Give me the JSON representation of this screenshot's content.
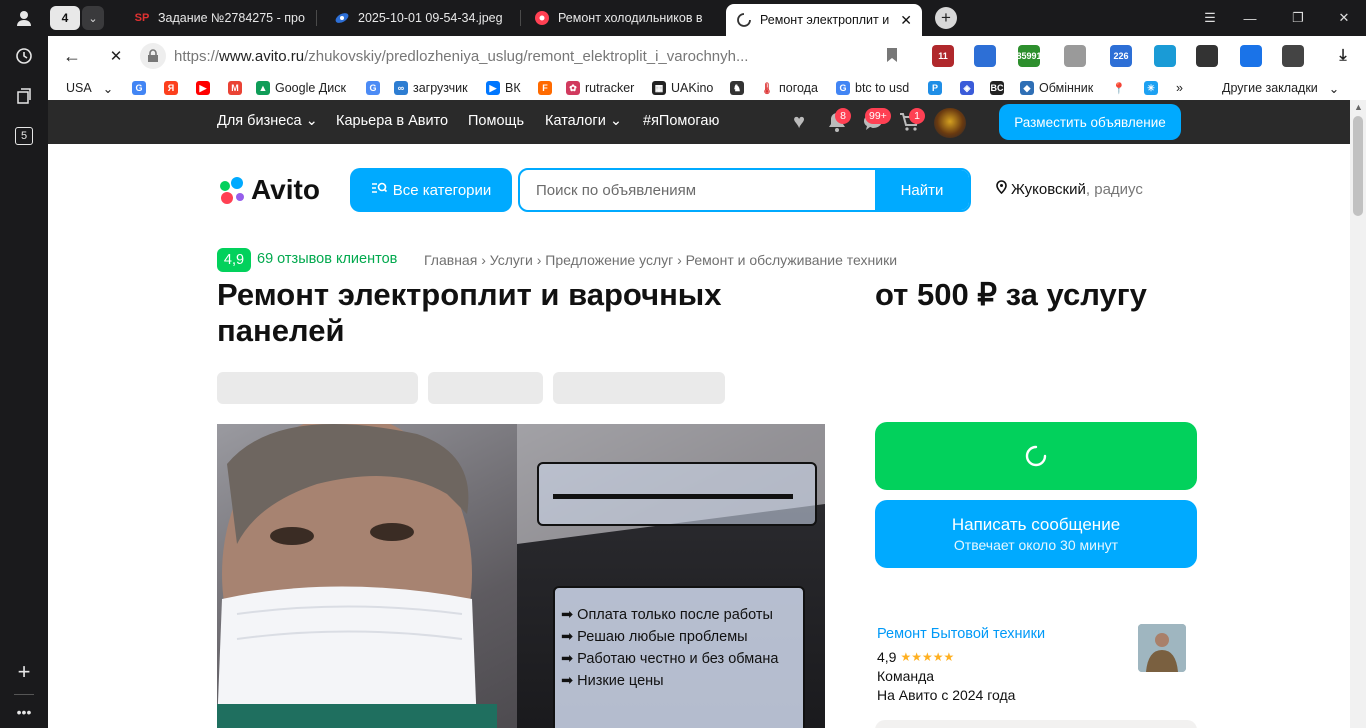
{
  "browser": {
    "tab_count": "4",
    "sidebar_count": "5",
    "tabs": [
      {
        "label": "Задание №2784275 - про",
        "icon": "SP"
      },
      {
        "label": "2025-10-01 09-54-34.jpeg"
      },
      {
        "label": "Ремонт холодильников в"
      },
      {
        "label": "Ремонт электроплит и в"
      }
    ],
    "url_scheme": "https://",
    "url_host": "www.avito.ru",
    "url_path": "/zhukovskiy/predlozheniya_uslug/remont_elektroplit_i_varochnyh...",
    "extensions": [
      {
        "name": "ext-11",
        "label": "11",
        "color": "#b0282c"
      },
      {
        "name": "ext-globe",
        "label": "",
        "color": "#2d6fd6"
      },
      {
        "name": "ext-85991",
        "label": "85991",
        "color": "#2d8f2d"
      },
      {
        "name": "ext-suitcase",
        "label": "",
        "color": "#9a9a9a"
      },
      {
        "name": "ext-226",
        "label": "226",
        "color": "#2d6fd6"
      },
      {
        "name": "ext-diamond",
        "label": "",
        "color": "#1a9bd6"
      },
      {
        "name": "ext-arrow",
        "label": "",
        "color": "#333"
      },
      {
        "name": "ext-download",
        "label": "",
        "color": "#1a73e8"
      },
      {
        "name": "ext-puzzle",
        "label": "",
        "color": "#444"
      }
    ],
    "bookmarks": [
      {
        "label": "USA",
        "icon": "",
        "color": "#fff"
      },
      {
        "label": "",
        "icon": "G",
        "color": "#4285f4"
      },
      {
        "label": "",
        "icon": "Я",
        "color": "#fc3f1d"
      },
      {
        "label": "",
        "icon": "▶",
        "color": "#ff0000"
      },
      {
        "label": "",
        "icon": "M",
        "color": "#ea4335"
      },
      {
        "label": "Google Диск",
        "icon": "▲",
        "color": "#0f9d58"
      },
      {
        "label": "",
        "icon": "G",
        "color": "#4c8bf5"
      },
      {
        "label": "загрузчик",
        "icon": "∞",
        "color": "#2d7dd2"
      },
      {
        "label": "ВК",
        "icon": "▶",
        "color": "#0077ff"
      },
      {
        "label": "",
        "icon": "F",
        "color": "#ff6a00"
      },
      {
        "label": "rutracker",
        "icon": "✿",
        "color": "#d13a5e"
      },
      {
        "label": "UAKino",
        "icon": "▦",
        "color": "#222"
      },
      {
        "label": "",
        "icon": "♞",
        "color": "#333"
      },
      {
        "label": "погода",
        "icon": "🌡",
        "color": "#fff"
      },
      {
        "label": "btc to usd",
        "icon": "G",
        "color": "#4285f4"
      },
      {
        "label": "",
        "icon": "P",
        "color": "#1f8ee6"
      },
      {
        "label": "",
        "icon": "◈",
        "color": "#3a5bd9"
      },
      {
        "label": "",
        "icon": "BC",
        "color": "#222"
      },
      {
        "label": "Обмінник",
        "icon": "◆",
        "color": "#2f6fb5"
      },
      {
        "label": "",
        "icon": "📍",
        "color": "#fff"
      },
      {
        "label": "",
        "icon": "✳",
        "color": "#1da1f2"
      }
    ],
    "more_bookmarks": "»",
    "other_bookmarks": "Другие закладки"
  },
  "avito": {
    "nav": {
      "business": "Для бизнеса",
      "career": "Карьера в Авито",
      "help": "Помощь",
      "catalogs": "Каталоги",
      "help_tag": "#яПомогаю",
      "notif_badge": "8",
      "messages_badge": "99+",
      "cart_badge": "1",
      "post_button": "Разместить объявление"
    },
    "logo_text": "Avito",
    "all_categories": "Все категории",
    "search_placeholder": "Поиск по объявлениям",
    "search_button": "Найти",
    "location": "Жуковский",
    "location_suffix": ", радиус",
    "rating": "4,9",
    "reviews": "69 отзывов клиентов",
    "breadcrumbs": [
      "Главная",
      "Услуги",
      "Предложение услуг",
      "Ремонт и обслуживание техники"
    ],
    "title": "Ремонт электроплит и варочных панелей",
    "price": "от 500 ₽ за услугу",
    "message_button": "Написать сообщение",
    "message_sub": "Отвечает около 30 минут",
    "seller": {
      "name": "Ремонт Бытовой техники",
      "rating": "4,9",
      "stars": "★★★★★",
      "type": "Команда",
      "since": "На Авито с 2024 года"
    },
    "photo_text": [
      "➡ Оплата только после работы",
      "➡ Решаю любые проблемы",
      "➡ Работаю честно и без обмана",
      "➡ Низкие цены"
    ]
  }
}
